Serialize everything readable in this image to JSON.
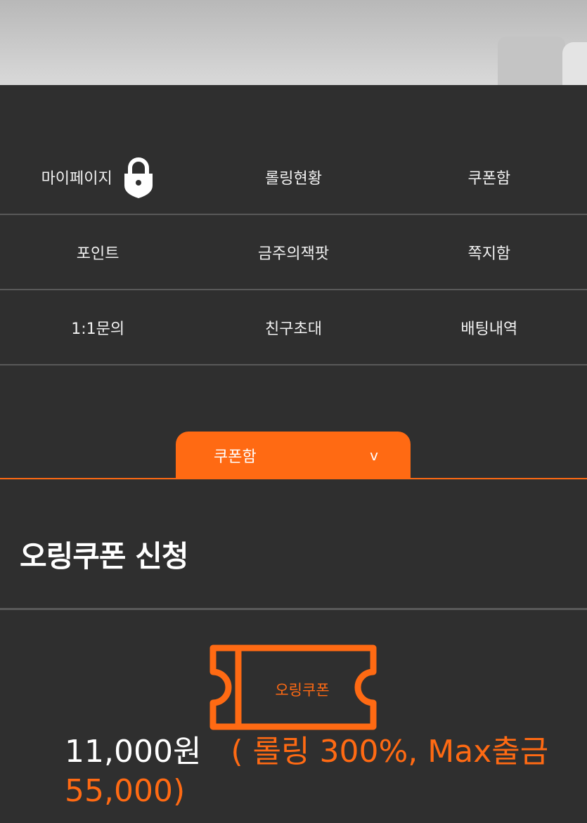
{
  "menu": {
    "rows": [
      [
        "마이페이지",
        "롤링현황",
        "쿠폰함"
      ],
      [
        "포인트",
        "금주의잭팟",
        "쪽지함"
      ],
      [
        "1:1문의",
        "친구초대",
        "배팅내역"
      ]
    ],
    "lock_icon": "lock-icon"
  },
  "tab": {
    "label": "쿠폰함",
    "chevron": "v"
  },
  "section": {
    "title": "오링쿠폰 신청"
  },
  "coupon": {
    "label": "오링쿠폰",
    "amount": "11,000원",
    "detail": "( 롤링 300%, Max출금 55,000)"
  },
  "colors": {
    "accent": "#ff6a13",
    "background": "#2f2f2f",
    "divider": "#595959"
  }
}
